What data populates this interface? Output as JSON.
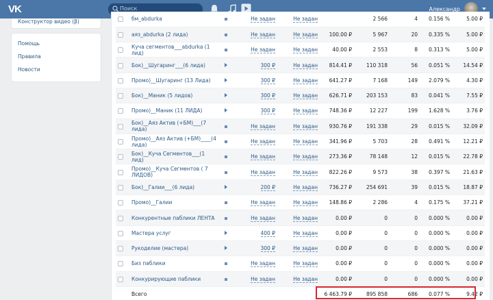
{
  "topbar": {
    "logo": "VK",
    "search_placeholder": "Поиск",
    "user_name": "Александр"
  },
  "sidebar": {
    "top_item": "Конструктор видео (β)",
    "links": [
      "Помощь",
      "Правила",
      "Новости"
    ]
  },
  "rows": [
    {
      "name": "бм_abdurka",
      "icon": "square",
      "price": "Не задан",
      "budget": "Не задан",
      "spent": "",
      "impressions": "2 566",
      "clicks": "4",
      "ctr": "0.156 %",
      "cpc": "5.00 ₽"
    },
    {
      "name": "аяз_abdurka (2 лида)",
      "icon": "square",
      "price": "Не задан",
      "budget": "Не задан",
      "spent": "100.00 ₽",
      "impressions": "5 967",
      "clicks": "20",
      "ctr": "0.335 %",
      "cpc": "5.00 ₽"
    },
    {
      "name": "Куча сегментов___abdurka (1 лид)",
      "icon": "square",
      "price": "Не задан",
      "budget": "Не задан",
      "spent": "40.00 ₽",
      "impressions": "2 553",
      "clicks": "8",
      "ctr": "0.313 %",
      "cpc": "5.00 ₽"
    },
    {
      "name": "Бок)__Шугаринг___(6 лида)",
      "icon": "play",
      "price": "300 ₽",
      "budget": "Не задан",
      "spent": "814.41 ₽",
      "impressions": "110 318",
      "clicks": "56",
      "ctr": "0.051 %",
      "cpc": "14.54 ₽"
    },
    {
      "name": "Промо)__Шугаринг (13 Лида)",
      "icon": "play",
      "price": "300 ₽",
      "budget": "Не задан",
      "spent": "641.27 ₽",
      "impressions": "7 168",
      "clicks": "149",
      "ctr": "2.079 %",
      "cpc": "4.30 ₽"
    },
    {
      "name": "Бок)__Маник (5 лидов)",
      "icon": "play",
      "price": "300 ₽",
      "budget": "Не задан",
      "spent": "626.71 ₽",
      "impressions": "203 153",
      "clicks": "83",
      "ctr": "0.041 %",
      "cpc": "7.55 ₽"
    },
    {
      "name": "Промо)__Маник (11 ЛИДА)",
      "icon": "play",
      "price": "300 ₽",
      "budget": "Не задан",
      "spent": "748.36 ₽",
      "impressions": "12 227",
      "clicks": "199",
      "ctr": "1.628 %",
      "cpc": "3.76 ₽"
    },
    {
      "name": "Бок)__Аяз Актив (+БМ)___(7 лида)",
      "icon": "square",
      "price": "Не задан",
      "budget": "Не задан",
      "spent": "930.76 ₽",
      "impressions": "191 338",
      "clicks": "29",
      "ctr": "0.015 %",
      "cpc": "32.09 ₽"
    },
    {
      "name": "Промо)__Аяз Актив (+БМ)____(4 лида)",
      "icon": "square",
      "price": "Не задан",
      "budget": "Не задан",
      "spent": "341.96 ₽",
      "impressions": "5 703",
      "clicks": "28",
      "ctr": "0.491 %",
      "cpc": "12.21 ₽"
    },
    {
      "name": "Бок)__Куча Сегментов___(1 лид)",
      "icon": "square",
      "price": "Не задан",
      "budget": "Не задан",
      "spent": "273.36 ₽",
      "impressions": "78 148",
      "clicks": "12",
      "ctr": "0.015 %",
      "cpc": "22.78 ₽"
    },
    {
      "name": "Промо)__Куча Сегментов ( 7 ЛИДОВ)",
      "icon": "square",
      "price": "Не задан",
      "budget": "Не задан",
      "spent": "822.26 ₽",
      "impressions": "9 573",
      "clicks": "38",
      "ctr": "0.397 %",
      "cpc": "21.63 ₽"
    },
    {
      "name": "Бок)__Галии___(6 лида)",
      "icon": "play",
      "price": "200 ₽",
      "budget": "Не задан",
      "spent": "736.27 ₽",
      "impressions": "254 691",
      "clicks": "39",
      "ctr": "0.015 %",
      "cpc": "18.87 ₽"
    },
    {
      "name": "Промо)__Галии",
      "icon": "square",
      "price": "Не задан",
      "budget": "Не задан",
      "spent": "148.86 ₽",
      "impressions": "2 286",
      "clicks": "4",
      "ctr": "0.175 %",
      "cpc": "37.21 ₽"
    },
    {
      "name": "Конкурентные паблики ЛЕНТА",
      "icon": "square",
      "price": "Не задан",
      "budget": "Не задан",
      "spent": "0.00 ₽",
      "impressions": "0",
      "clicks": "0",
      "ctr": "0.000 %",
      "cpc": "0.00 ₽"
    },
    {
      "name": "Мастера услуг",
      "icon": "play",
      "price": "400 ₽",
      "budget": "Не задан",
      "spent": "0.00 ₽",
      "impressions": "0",
      "clicks": "0",
      "ctr": "0.000 %",
      "cpc": "0.00 ₽"
    },
    {
      "name": "Рукоделие (мастера)",
      "icon": "play",
      "price": "300 ₽",
      "budget": "Не задан",
      "spent": "0.00 ₽",
      "impressions": "0",
      "clicks": "0",
      "ctr": "0.000 %",
      "cpc": "0.00 ₽"
    },
    {
      "name": "Биз паблики",
      "icon": "square",
      "price": "Не задан",
      "budget": "Не задан",
      "spent": "0.00 ₽",
      "impressions": "0",
      "clicks": "0",
      "ctr": "0.000 %",
      "cpc": "0.00 ₽"
    },
    {
      "name": "Конкурирующие паблики",
      "icon": "square",
      "price": "Не задан",
      "budget": "Не задан",
      "spent": "0.00 ₽",
      "impressions": "0",
      "clicks": "0",
      "ctr": "0.000 %",
      "cpc": "0.00 ₽"
    }
  ],
  "total": {
    "label": "Всего",
    "spent": "6 463.79 ₽",
    "impressions": "895 858",
    "clicks": "686",
    "ctr": "0.077 %",
    "cpc": "9.42 ₽"
  },
  "colors": {
    "header": "#4a76a8",
    "link": "#2a5885",
    "highlight": "#d8262f"
  }
}
